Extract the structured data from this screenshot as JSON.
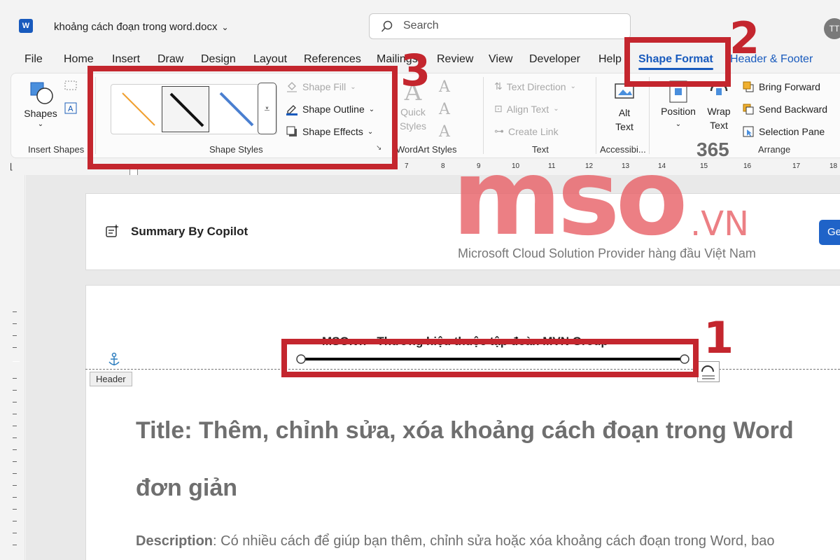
{
  "titlebar": {
    "app_icon_letter": "W",
    "doc_title": "khoảng cách đoạn trong word.docx",
    "search_placeholder": "Search",
    "avatar_initials": "TT"
  },
  "tabs": [
    {
      "label": "File"
    },
    {
      "label": "Home"
    },
    {
      "label": "Insert"
    },
    {
      "label": "Draw"
    },
    {
      "label": "Design"
    },
    {
      "label": "Layout"
    },
    {
      "label": "References"
    },
    {
      "label": "Mailings"
    },
    {
      "label": "Review"
    },
    {
      "label": "View"
    },
    {
      "label": "Developer"
    },
    {
      "label": "Help"
    },
    {
      "label": "Shape Format"
    },
    {
      "label": "Header & Footer"
    }
  ],
  "ribbon": {
    "insert_shapes": {
      "shapes_label": "Shapes",
      "group_label": "Insert Shapes"
    },
    "shape_styles": {
      "shape_fill": "Shape Fill",
      "shape_outline": "Shape Outline",
      "shape_effects": "Shape Effects",
      "group_label": "Shape Styles"
    },
    "wordart": {
      "quick_styles": "Quick Styles",
      "group_label": "WordArt Styles"
    },
    "text": {
      "text_direction": "Text Direction",
      "align_text": "Align Text",
      "create_link": "Create Link",
      "group_label": "Text"
    },
    "accessibility": {
      "alt_text": "Alt Text",
      "group_label": "Accessibi..."
    },
    "arrange": {
      "position": "Position",
      "wrap_text": "Wrap Text",
      "bring_forward": "Bring Forward",
      "send_backward": "Send Backward",
      "selection_pane": "Selection Pane",
      "group_label": "Arrange"
    }
  },
  "ruler": {
    "ticks": [
      "7",
      "8",
      "9",
      "10",
      "11",
      "12",
      "13",
      "14",
      "15",
      "16",
      "17",
      "18"
    ]
  },
  "copilot": {
    "label": "Summary By Copilot",
    "button": "Ge"
  },
  "document": {
    "header_text": "MSO.vn - Thương hiệu thuộc tập đoàn MVN Group",
    "header_tag": "Header",
    "title": "Title: Thêm, chỉnh sửa, xóa khoảng cách đoạn trong Word đơn giản",
    "desc_label": "Description",
    "desc_text": ": Có nhiều cách để giúp bạn thêm, chỉnh sửa hoặc xóa khoảng cách đoạn trong Word, bao"
  },
  "callouts": {
    "one": "1",
    "two": "2",
    "three": "3"
  },
  "watermark": {
    "brand": "mso",
    "suffix": ".VN",
    "tagline": "Microsoft Cloud Solution Provider hàng đầu Việt Nam",
    "badge": "365"
  },
  "colors": {
    "accent": "#185abd",
    "callout": "#c4262e",
    "watermark": "#e8646a"
  }
}
